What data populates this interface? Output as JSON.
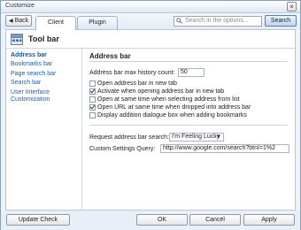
{
  "window": {
    "title": "Customize",
    "close_glyph": "×"
  },
  "nav": {
    "back_label": "Back",
    "tabs": [
      {
        "label": "Client",
        "active": true
      },
      {
        "label": "Plugin",
        "active": false
      }
    ],
    "search": {
      "placeholder": "Search in the options...",
      "button_label": "Search"
    }
  },
  "header": {
    "title": "Tool bar",
    "icon": "toolbar-icon"
  },
  "sidebar": {
    "items": [
      {
        "label": "Address bar",
        "active": true
      },
      {
        "label": "Bookmarks bar"
      },
      {
        "label": "Page search bar"
      },
      {
        "label": "Search bar"
      },
      {
        "label": "User Interface"
      },
      {
        "label": "Customization"
      }
    ]
  },
  "main": {
    "section_title": "Address bar",
    "history": {
      "label": "Address bar max history count:",
      "value": "50"
    },
    "checkboxes": [
      {
        "label": "Open address bar in new tab",
        "checked": false
      },
      {
        "label": "Activate when opening address bar in new tab",
        "checked": true
      },
      {
        "label": "Open at same time when selecting address from list",
        "checked": false
      },
      {
        "label": "Open URL at same time when dropped into address bar",
        "checked": true
      },
      {
        "label": "Display addition dialogue box when adding bookmarks",
        "checked": false
      }
    ],
    "request_search": {
      "label": "Request address bar search:",
      "value": "I'm Feeling Lucky"
    },
    "custom_query": {
      "label": "Custom Settings Query:",
      "value": "http://www.google.com/search?btnI=1%2"
    }
  },
  "footer": {
    "update_label": "Update Check",
    "ok_label": "OK",
    "cancel_label": "Cancel",
    "apply_label": "Apply"
  }
}
